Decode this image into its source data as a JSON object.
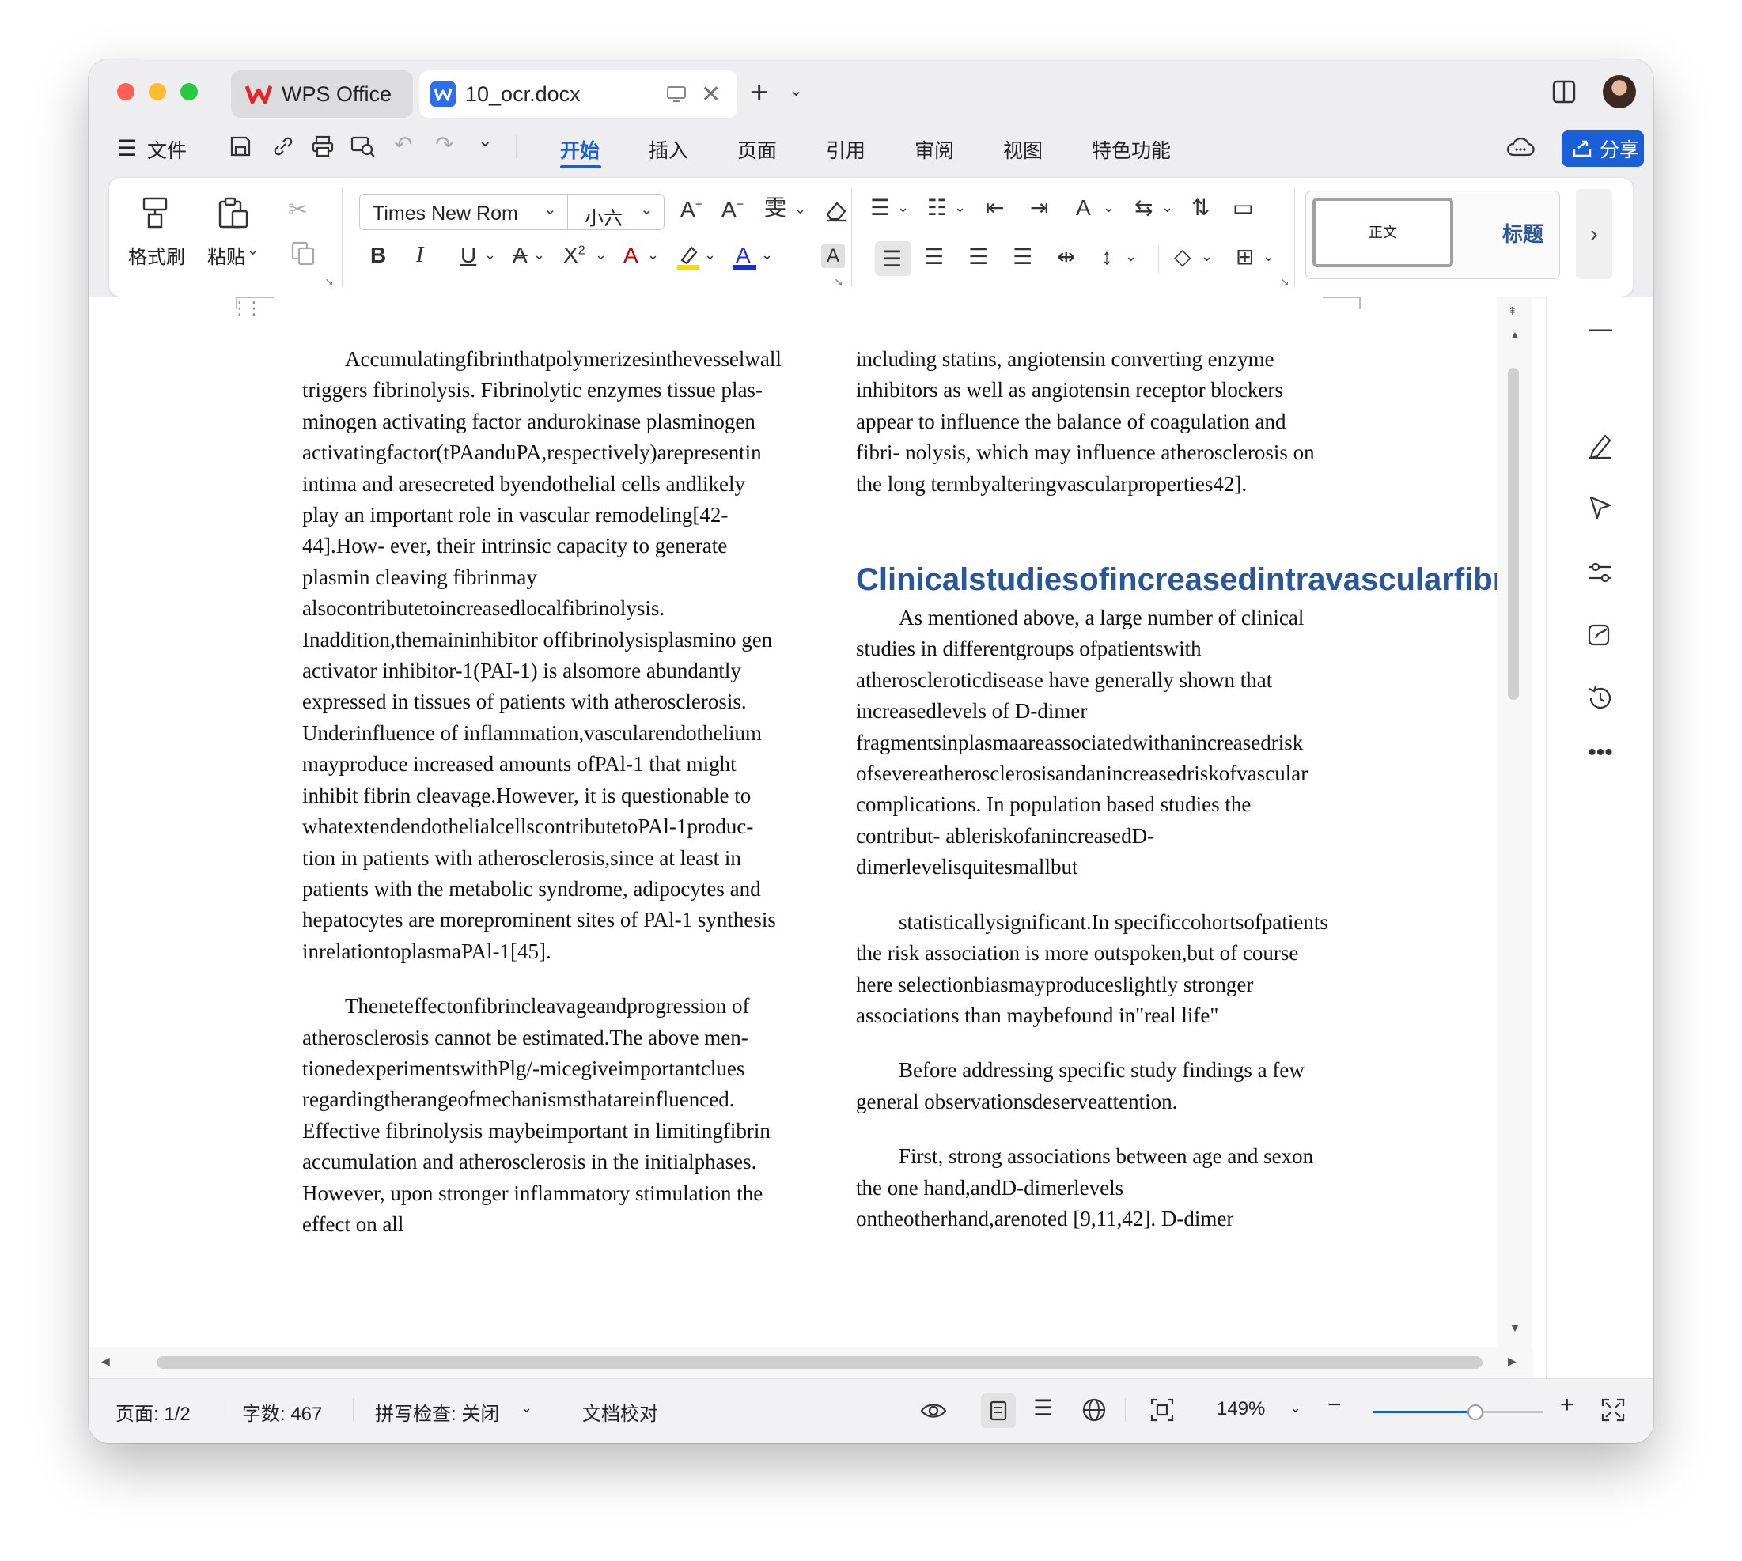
{
  "tabs": {
    "home": "WPS Office",
    "doc": "10_ocr.docx"
  },
  "menu": {
    "file": "文件",
    "tabs": [
      "开始",
      "插入",
      "页面",
      "引用",
      "审阅",
      "视图",
      "特色功能"
    ],
    "share": "分享"
  },
  "ribbon": {
    "format_painter": "格式刷",
    "paste": "粘贴",
    "font_name": "Times New Rom",
    "font_size": "小六",
    "style_normal": "正文",
    "style_heading": "标题"
  },
  "document": {
    "left_para1": "Accumulatingfibrinthatpolymerizesinthevesselwall triggers fibrinolysis. Fibrinolytic enzymes tissue plas- minogen activating factor andurokinase plasminogen activatingfactor(tPAanduPA,respectively)arepresentin intima and aresecreted byendothelial cells andlikely play an important role in vascular remodeling[42-44].How- ever, their intrinsic capacity to generate plasmin cleaving fibrinmay alsocontributetoincreasedlocalfibrinolysis. Inaddition,themaininhibitor offibrinolysisplasmino gen activator inhibitor-1(PAI-1) is alsomore abundantly expressed in tissues of patients with atherosclerosis. Underinfluence of inflammation,vascularendothelium mayproduce increased amounts ofPAl-1 that might inhibit fibrin cleavage.However, it is questionable to whatextendendothelialcellscontributetoPAl-1produc- tion in patients with atherosclerosis,since at least in patients with the metabolic syndrome, adipocytes and hepatocytes are moreprominent sites of PAl-1 synthesis inrelationtoplasmaPAl-1[45].",
    "left_para2": "Theneteffectonfibrincleavageandprogression of atherosclerosis cannot be estimated.The above men- tionedexperimentswithPlg/-micegiveimportantclues regardingtherangeofmechanismsthatareinfluenced. Effective fibrinolysis maybeimportant in limitingfibrin accumulation and atherosclerosis in the initialphases. However, upon stronger inflammatory stimulation the effect on all",
    "right_para1": "including statins, angiotensin converting enzyme inhibitors as well as angiotensin receptor blockers appear to influence the balance of coagulation and fibri- nolysis, which may influence atherosclerosis on the long termbyalteringvascularproperties42].",
    "heading": "Clinicalstudiesofincreasedintravascularfibrin",
    "right_para2": "As mentioned above, a large number of clinical studies in differentgroups ofpatientswith atheroscleroticdisease have generally shown that increasedlevels of D-dimer fragmentsinplasmaareassociatedwithanincreasedrisk ofsevereatherosclerosisandanincreasedriskofvascular complications. In population based studies the contribut- ableriskofanincreasedD-dimerlevelisquitesmallbut",
    "right_para3": "statisticallysignificant.In specificcohortsofpatients the risk association is more outspoken,but of course here selectionbiasmayproduceslightly stronger associations than maybefound in\"real life\"",
    "right_para4": "Before addressing specific study findings a few general observationsdeserveattention.",
    "right_para5": "First, strong associations between age and sexon the one hand,andD-dimerlevels ontheotherhand,arenoted [9,11,42]. D-dimer"
  },
  "status": {
    "page": "页面: 1/2",
    "words": "字数: 467",
    "spell": "拼写检查: 关闭",
    "proof": "文档校对",
    "zoom": "149%",
    "zoom_level": 0.6
  },
  "colors": {
    "accent": "#1a5fd8",
    "heading": "#2b579a",
    "close": "#fe5f57",
    "minimize": "#febc2e",
    "maximize": "#28c840"
  }
}
